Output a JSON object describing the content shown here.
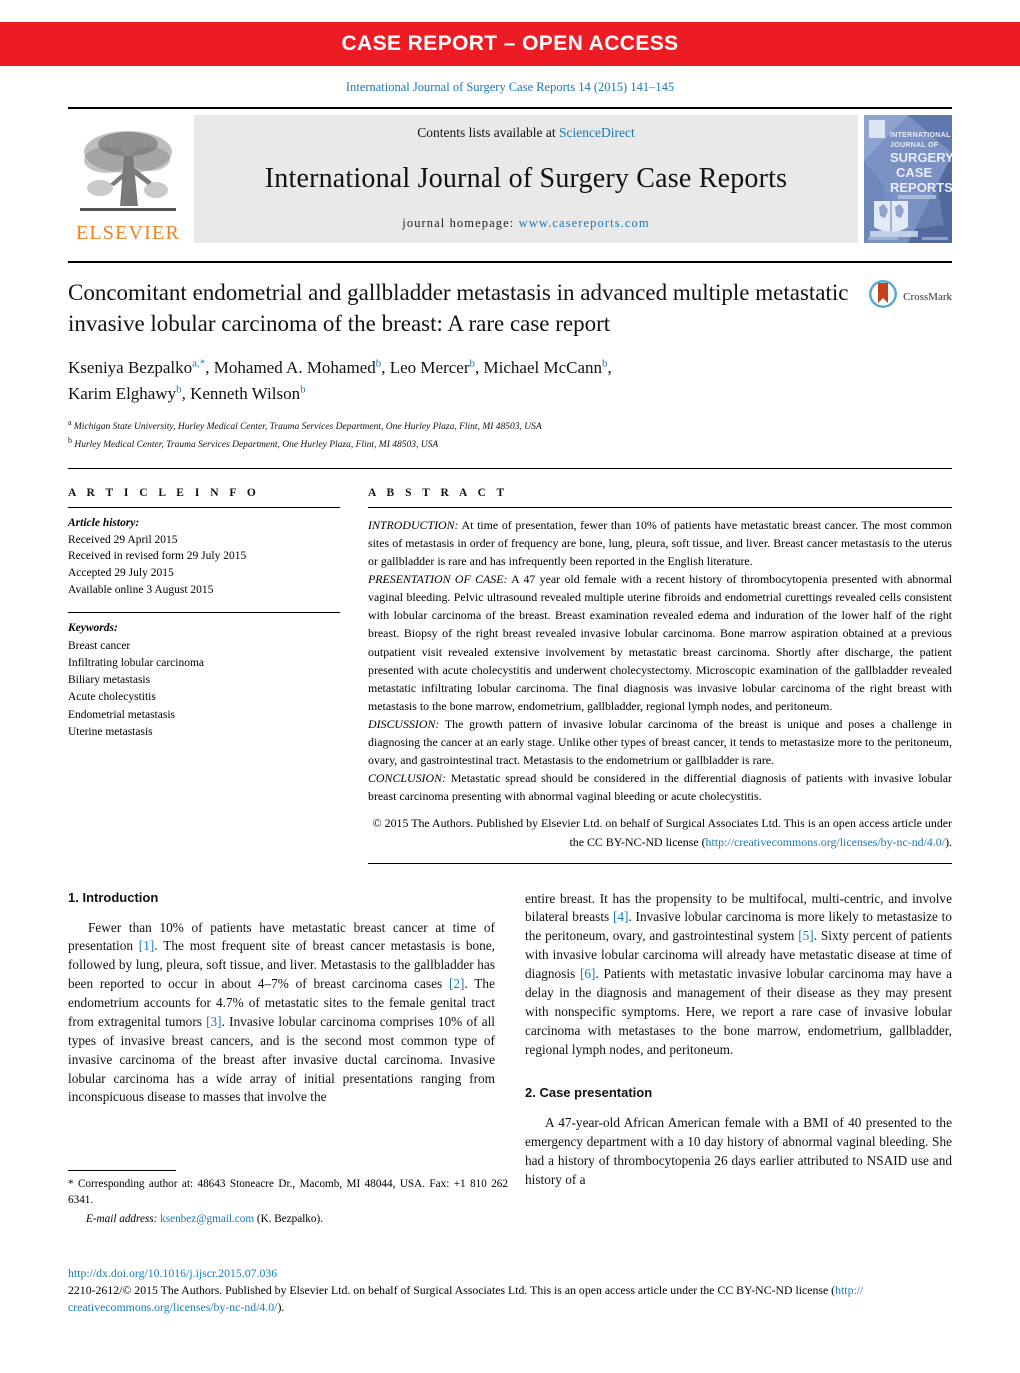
{
  "banner": {
    "text": "CASE REPORT – OPEN ACCESS"
  },
  "citation": "International Journal of Surgery Case Reports 14 (2015) 141–145",
  "masthead": {
    "publisher_word": "ELSEVIER",
    "contents_prefix": "Contents lists available at ",
    "contents_link": "ScienceDirect",
    "journal_name": "International Journal of Surgery Case Reports",
    "homepage_prefix": "journal homepage: ",
    "homepage_url": "www.casereports.com",
    "cover_lines": [
      "INTERNATIONAL",
      "JOURNAL OF",
      "SURGERY",
      "CASE",
      "REPORTS"
    ]
  },
  "article": {
    "title": "Concomitant endometrial and gallbladder metastasis in advanced multiple metastatic invasive lobular carcinoma of the breast: A rare case report",
    "crossmark_label": "CrossMark",
    "authors_line1": "Kseniya Bezpalko",
    "authors_line1_sup": "a,*",
    "authors_rest": ", Mohamed A. Mohamed b, Leo Mercer b, Michael McCann b, Karim Elghawy b, Kenneth Wilson b",
    "affiliation_a": "Michigan State University, Hurley Medical Center, Trauma Services Department, One Hurley Plaza, Flint, MI 48503, USA",
    "affiliation_b": "Hurley Medical Center, Trauma Services Department, One Hurley Plaza, Flint, MI 48503, USA"
  },
  "info": {
    "heading": "A R T I C L E   I N F O",
    "history_label": "Article history:",
    "history": [
      "Received 29 April 2015",
      "Received in revised form 29 July 2015",
      "Accepted 29 July 2015",
      "Available online 3 August 2015"
    ],
    "keywords_label": "Keywords:",
    "keywords": [
      "Breast cancer",
      "Infiltrating lobular carcinoma",
      "Biliary metastasis",
      "Acute cholecystitis",
      "Endometrial metastasis",
      "Uterine metastasis"
    ]
  },
  "abstract": {
    "heading": "A B S T R A C T",
    "sections": [
      {
        "label": "INTRODUCTION:",
        "text": " At time of presentation, fewer than 10% of patients have metastatic breast cancer. The most common sites of metastasis in order of frequency are bone, lung, pleura, soft tissue, and liver. Breast cancer metastasis to the uterus or gallbladder is rare and has infrequently been reported in the English literature."
      },
      {
        "label": "PRESENTATION OF CASE:",
        "text": " A 47 year old female with a recent history of thrombocytopenia presented with abnormal vaginal bleeding. Pelvic ultrasound revealed multiple uterine fibroids and endometrial curettings revealed cells consistent with lobular carcinoma of the breast. Breast examination revealed edema and induration of the lower half of the right breast. Biopsy of the right breast revealed invasive lobular carcinoma. Bone marrow aspiration obtained at a previous outpatient visit revealed extensive involvement by metastatic breast carcinoma. Shortly after discharge, the patient presented with acute cholecystitis and underwent cholecystectomy. Microscopic examination of the gallbladder revealed metastatic infiltrating lobular carcinoma. The final diagnosis was invasive lobular carcinoma of the right breast with metastasis to the bone marrow, endometrium, gallbladder, regional lymph nodes, and peritoneum."
      },
      {
        "label": "DISCUSSION:",
        "text": " The growth pattern of invasive lobular carcinoma of the breast is unique and poses a challenge in diagnosing the cancer at an early stage. Unlike other types of breast cancer, it tends to metastasize more to the peritoneum, ovary, and gastrointestinal tract. Metastasis to the endometrium or gallbladder is rare."
      },
      {
        "label": "CONCLUSION:",
        "text": " Metastatic spread should be considered in the differential diagnosis of patients with invasive lobular breast carcinoma presenting with abnormal vaginal bleeding or acute cholecystitis."
      }
    ],
    "copyright_text": "© 2015 The Authors. Published by Elsevier Ltd. on behalf of Surgical Associates Ltd. This is an open access article under the CC BY-NC-ND license (",
    "copyright_link": "http://creativecommons.org/licenses/by-nc-nd/4.0/",
    "copyright_tail": ")."
  },
  "body": {
    "intro_heading": "1.  Introduction",
    "intro_p1_a": "Fewer than 10% of patients have metastatic breast cancer at time of presentation ",
    "ref1": "[1]",
    "intro_p1_b": ". The most frequent site of breast cancer metastasis is bone, followed by lung, pleura, soft tissue, and liver. Metastasis to the gallbladder has been reported to occur in about 4–7% of breast carcinoma cases ",
    "ref2": "[2]",
    "intro_p1_c": ". The endometrium accounts for 4.7% of metastatic sites to the female genital tract from extragenital tumors ",
    "ref3": "[3]",
    "intro_p1_d": ". Invasive lobular carcinoma comprises 10% of all types of invasive breast cancers, and is the second most common type of invasive carcinoma of the breast after invasive ductal carcinoma. Invasive lobular carcinoma has a wide array of initial presentations ranging from inconspicuous disease to masses that involve the",
    "intro_p1_cont_a": "entire breast. It has the propensity to be multifocal, multi-centric, and involve bilateral breasts ",
    "ref4": "[4]",
    "intro_p1_cont_b": ". Invasive lobular carcinoma is more likely to metastasize to the peritoneum, ovary, and gastrointestinal system ",
    "ref5": "[5]",
    "intro_p1_cont_c": ". Sixty percent of patients with invasive lobular carcinoma will already have metastatic disease at time of diagnosis ",
    "ref6": "[6]",
    "intro_p1_cont_d": ". Patients with metastatic invasive lobular carcinoma may have a delay in the diagnosis and management of their disease as they may present with nonspecific symptoms. Here, we report a rare case of invasive lobular carcinoma with metastases to the bone marrow, endometrium, gallbladder, regional lymph nodes, and peritoneum.",
    "case_heading": "2.  Case presentation",
    "case_p1": "A 47-year-old African American female with a BMI of 40 presented to the emergency department with a 10 day history of abnormal vaginal bleeding. She had a history of thrombocytopenia 26 days earlier attributed to NSAID use and history of a"
  },
  "footnotes": {
    "corresponding": "*  Corresponding author at: 48643 Stoneacre Dr., Macomb, MI 48044, USA. Fax: +1 810 262 6341.",
    "email_label": "E-mail address: ",
    "email": "ksenbez@gmail.com",
    "email_tail": " (K. Bezpalko)."
  },
  "footer": {
    "doi": "http://dx.doi.org/10.1016/j.ijscr.2015.07.036",
    "issn_a": "2210-2612/© 2015 The Authors. Published by Elsevier Ltd. on behalf of Surgical Associates Ltd. This is an open access article under the CC BY-NC-ND license (",
    "issn_link1": "http://",
    "issn_link2": "creativecommons.org/licenses/by-nc-nd/4.0/",
    "issn_tail": ")."
  },
  "colors": {
    "banner_red": "#ED1C24",
    "link_blue": "#1879B7",
    "elsevier_orange": "#F08020",
    "panel_gray": "#E9E9E9"
  }
}
